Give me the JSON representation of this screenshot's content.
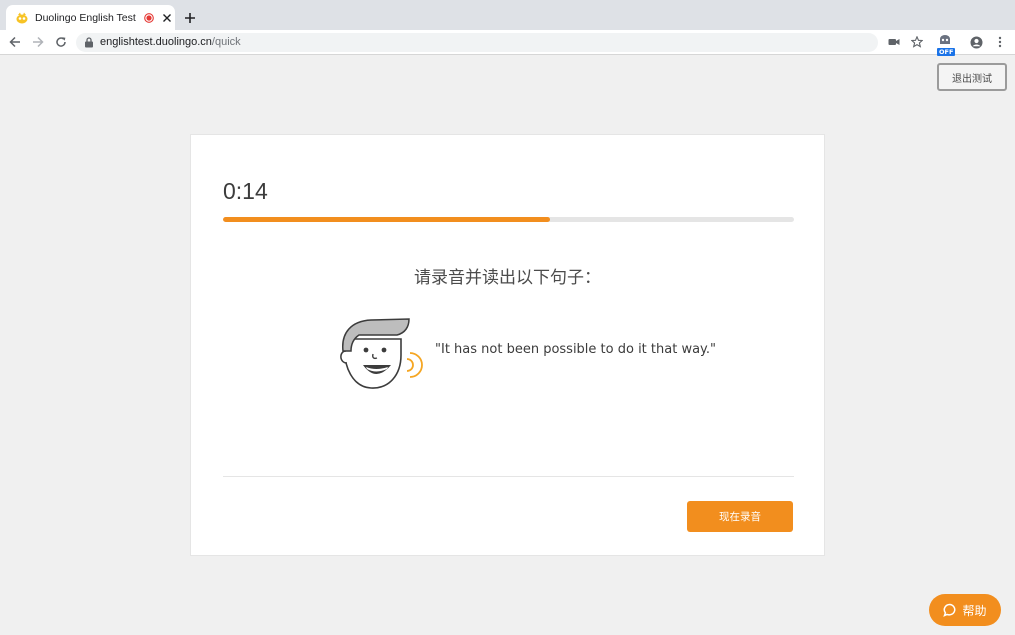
{
  "browser": {
    "tab": {
      "title": "Duolingo English Test",
      "favicon": "duolingo-icon",
      "recording_indicator_color": "#e53935"
    },
    "address": {
      "host": "englishtest.duolingo.cn",
      "path": "/quick"
    },
    "extension_badge": "OFF"
  },
  "page": {
    "exit_button": "退出测试",
    "timer": "0:14",
    "progress": {
      "fraction": 0.573,
      "color": "#f28e1e"
    },
    "instruction": "请录音并读出以下句子：",
    "sentence": "\"It has not been possible to do it that way.\"",
    "record_button": "现在录音",
    "help_button": "帮助",
    "accent_color": "#f28e1e"
  }
}
